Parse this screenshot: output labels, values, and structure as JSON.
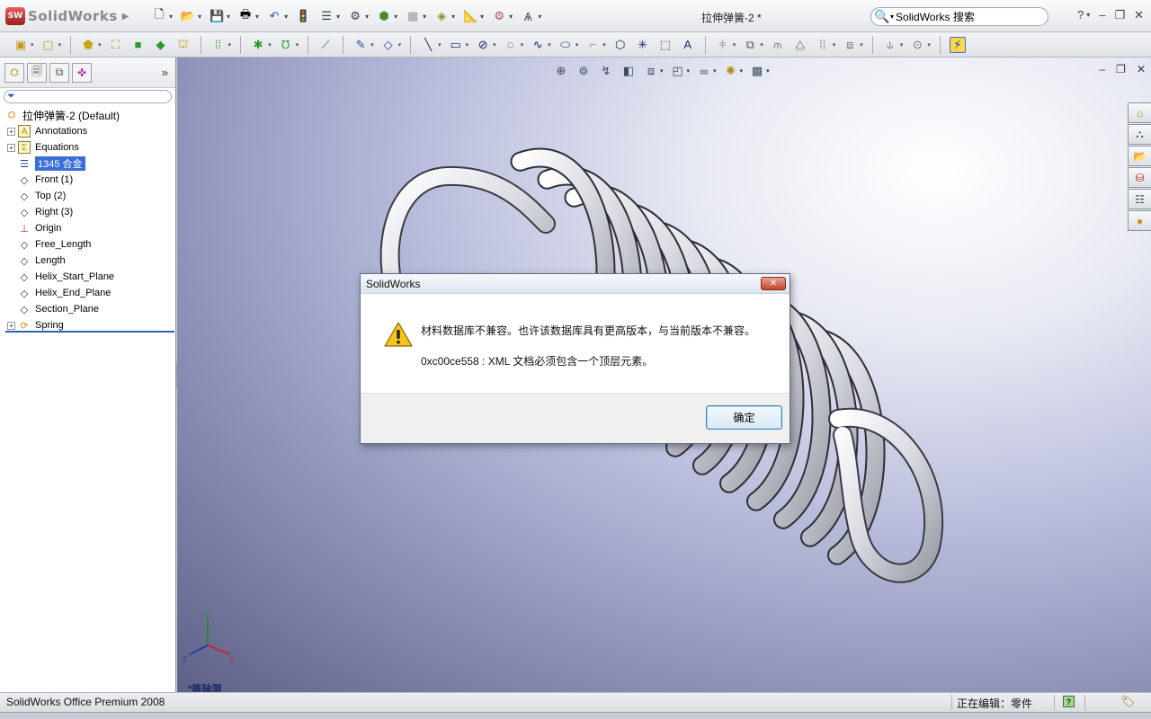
{
  "app": {
    "logo_text": "SolidWorks",
    "logo_badge": "SW",
    "document_title": "拉伸弹簧-2 *",
    "search_placeholder": "SolidWorks 搜索",
    "help_label": "?",
    "window_controls": [
      "–",
      "❐",
      "✕"
    ]
  },
  "icons": {
    "quick_access": [
      "new-icon",
      "open-icon",
      "save-icon",
      "print-icon",
      "undo-icon",
      "rebuild-icon",
      "options-icon"
    ],
    "toolbar": [
      "extrude-icon",
      "revolve-icon",
      "sweep-icon",
      "loft-icon",
      "fillet-icon",
      "pattern-icon",
      "sketch-icon",
      "line-icon",
      "rectangle-icon",
      "circle-icon",
      "spline-icon",
      "dimension-icon"
    ],
    "view": [
      "zoom-fit-icon",
      "zoom-area-icon",
      "previous-view-icon",
      "section-view-icon",
      "view-orientation-icon",
      "display-style-icon",
      "hide-show-icon",
      "scene-icon"
    ],
    "task_pane": [
      "home-icon",
      "design-library-icon",
      "file-explorer-icon",
      "view-palette-icon",
      "appearances-icon",
      "custom-properties-icon"
    ]
  },
  "feature_tree": {
    "root": "拉伸弹簧-2  (Default)",
    "items": [
      {
        "label": "Annotations",
        "expandable": true,
        "icon": "annotations-icon"
      },
      {
        "label": "Equations",
        "expandable": true,
        "icon": "equations-icon"
      },
      {
        "label": "1345 合金",
        "expandable": false,
        "icon": "material-icon",
        "selected": true
      },
      {
        "label": "Front (1)",
        "expandable": false,
        "icon": "plane-icon"
      },
      {
        "label": "Top (2)",
        "expandable": false,
        "icon": "plane-icon"
      },
      {
        "label": "Right (3)",
        "expandable": false,
        "icon": "plane-icon"
      },
      {
        "label": "Origin",
        "expandable": false,
        "icon": "origin-icon"
      },
      {
        "label": "Free_Length",
        "expandable": false,
        "icon": "plane-icon"
      },
      {
        "label": "Length",
        "expandable": false,
        "icon": "plane-icon"
      },
      {
        "label": "Helix_Start_Plane",
        "expandable": false,
        "icon": "plane-icon"
      },
      {
        "label": "Helix_End_Plane",
        "expandable": false,
        "icon": "plane-icon"
      },
      {
        "label": "Section_Plane",
        "expandable": false,
        "icon": "plane-icon"
      },
      {
        "label": "Spring",
        "expandable": true,
        "icon": "feature-icon"
      }
    ]
  },
  "graphics": {
    "orientation_label": "*等轴测",
    "triad_axes": [
      "Y",
      "X",
      "Z"
    ]
  },
  "dialog": {
    "title": "SolidWorks",
    "message_line1": "材料数据库不兼容。也许该数据库具有更高版本，与当前版本不兼容。",
    "message_line2": "0xc00ce558 : XML 文档必须包含一个顶层元素。",
    "ok_label": "确定",
    "close_label": "✕"
  },
  "status": {
    "left": "SolidWorks Office Premium 2008",
    "right": "正在编辑：零件",
    "help": "?"
  }
}
